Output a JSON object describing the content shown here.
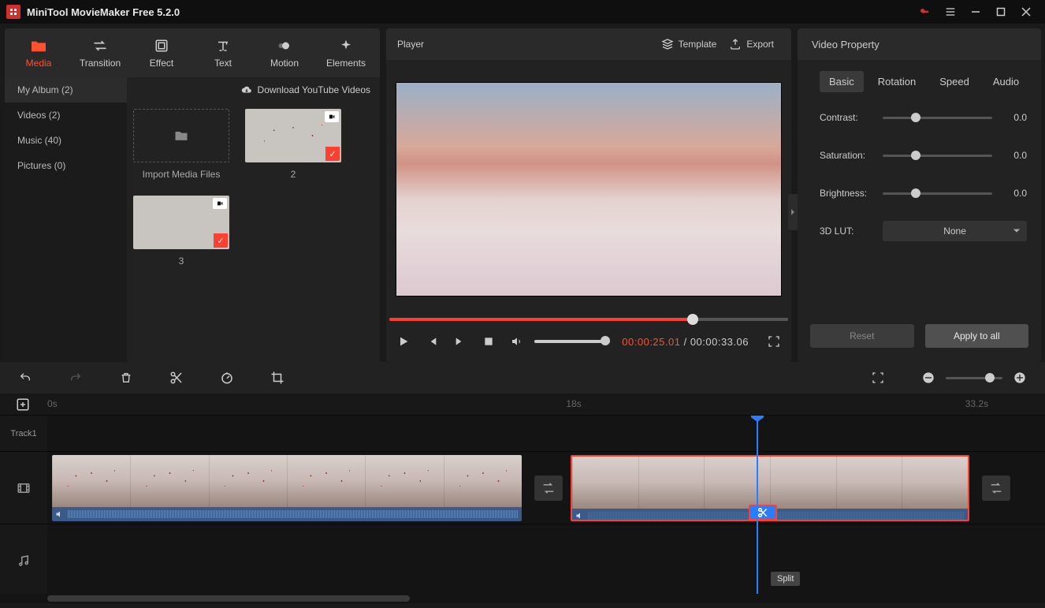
{
  "title": "MiniTool MovieMaker Free 5.2.0",
  "toolbar_tabs": [
    {
      "label": "Media",
      "icon": "folder"
    },
    {
      "label": "Transition",
      "icon": "swap"
    },
    {
      "label": "Effect",
      "icon": "effect"
    },
    {
      "label": "Text",
      "icon": "text"
    },
    {
      "label": "Motion",
      "icon": "motion"
    },
    {
      "label": "Elements",
      "icon": "sparkle"
    }
  ],
  "sidebar": {
    "items": [
      {
        "label": "My Album (2)",
        "active": true
      },
      {
        "label": "Videos (2)"
      },
      {
        "label": "Music (40)"
      },
      {
        "label": "Pictures (0)"
      }
    ],
    "download_label": "Download YouTube Videos"
  },
  "media": {
    "import_label": "Import Media Files",
    "items": [
      {
        "caption": "2",
        "type": "video"
      },
      {
        "caption": "3",
        "type": "video"
      }
    ]
  },
  "player": {
    "title": "Player",
    "template": "Template",
    "export": "Export",
    "current_tc": "00:00:25.01",
    "total_tc": "00:00:33.06",
    "sep": " / "
  },
  "property": {
    "title": "Video Property",
    "tabs": [
      "Basic",
      "Rotation",
      "Speed",
      "Audio"
    ],
    "rows": [
      {
        "label": "Contrast:",
        "value": "0.0"
      },
      {
        "label": "Saturation:",
        "value": "0.0"
      },
      {
        "label": "Brightness:",
        "value": "0.0"
      }
    ],
    "lut_label": "3D LUT:",
    "lut_value": "None",
    "reset": "Reset",
    "apply": "Apply to all"
  },
  "timeline": {
    "marks": [
      {
        "t": "0s",
        "pos": 0
      },
      {
        "t": "18s",
        "pos": 52
      },
      {
        "t": "33.2s",
        "pos": 92
      }
    ],
    "track_labels": [
      "Track1"
    ],
    "split_tip": "Split"
  }
}
